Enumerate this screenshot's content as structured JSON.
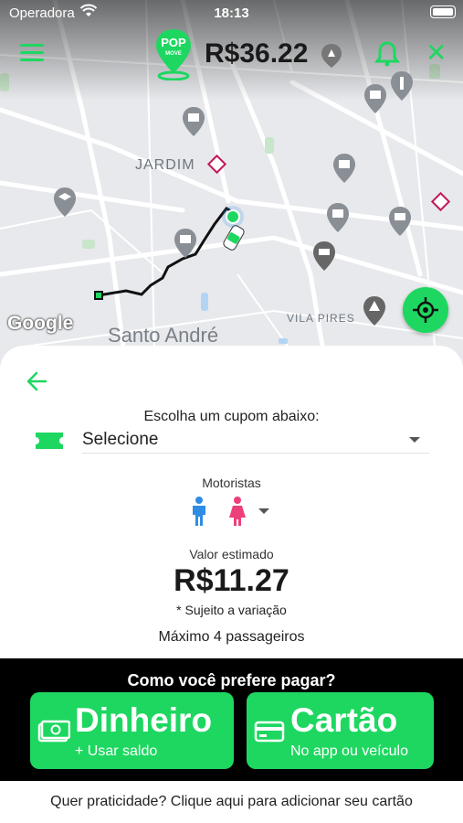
{
  "status": {
    "carrier": "Operadora",
    "time": "18:13"
  },
  "header": {
    "logo_text_top": "POP",
    "logo_text_bottom": "MOVE",
    "price": "R$36.22"
  },
  "map": {
    "labels": {
      "jardim": "JARDIM",
      "santo_andre": "Santo André",
      "vila_pires": "VILA PIRES"
    },
    "provider": "Google"
  },
  "sheet": {
    "coupon_title": "Escolha um cupom abaixo:",
    "coupon_value": "Selecione",
    "drivers_label": "Motoristas",
    "estimate_label": "Valor estimado",
    "estimate_value": "R$11.27",
    "estimate_note": "* Sujeito a variação",
    "passengers": "Máximo 4 passageiros"
  },
  "payment": {
    "title": "Como você prefere pagar?",
    "cash": {
      "label": "Dinheiro",
      "sub": "+ Usar saldo"
    },
    "card": {
      "label": "Cartão",
      "sub": "No app ou veículo"
    }
  },
  "footer": {
    "link": "Quer praticidade? Clique aqui para adicionar seu cartão"
  },
  "colors": {
    "accent": "#1ed760",
    "male": "#2f8de4",
    "female": "#ec407a"
  }
}
